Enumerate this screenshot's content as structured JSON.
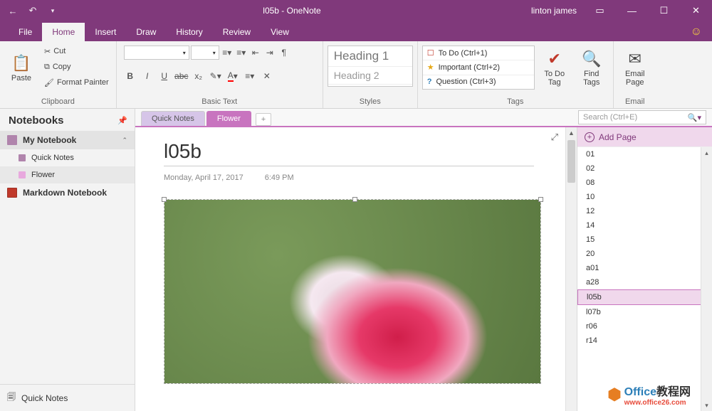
{
  "window": {
    "title": "l05b  -  OneNote",
    "user": "linton james"
  },
  "menu": {
    "file": "File",
    "home": "Home",
    "insert": "Insert",
    "draw": "Draw",
    "history": "History",
    "review": "Review",
    "view": "View"
  },
  "ribbon": {
    "clipboard": {
      "label": "Clipboard",
      "paste": "Paste",
      "cut": "Cut",
      "copy": "Copy",
      "format_painter": "Format Painter"
    },
    "basic_text": {
      "label": "Basic Text"
    },
    "styles": {
      "label": "Styles",
      "h1": "Heading 1",
      "h2": "Heading 2"
    },
    "tags": {
      "label": "Tags",
      "items": [
        {
          "icon": "☐",
          "color": "#c0392b",
          "label": "To Do (Ctrl+1)"
        },
        {
          "icon": "★",
          "color": "#e6a817",
          "label": "Important (Ctrl+2)"
        },
        {
          "icon": "?",
          "color": "#2c7fb8",
          "label": "Question (Ctrl+3)"
        }
      ],
      "todo_tag": "To Do\nTag",
      "find_tags": "Find\nTags"
    },
    "email": {
      "label": "Email",
      "email_page": "Email\nPage"
    }
  },
  "notebooks": {
    "header": "Notebooks",
    "my_notebook": "My Notebook",
    "quick_notes": "Quick Notes",
    "flower": "Flower",
    "markdown": "Markdown Notebook",
    "footer": "Quick Notes"
  },
  "sections": {
    "quick_notes": "Quick Notes",
    "flower": "Flower"
  },
  "search": {
    "placeholder": "Search (Ctrl+E)"
  },
  "page": {
    "title": "l05b",
    "date": "Monday, April 17, 2017",
    "time": "6:49 PM"
  },
  "pagelist": {
    "add": "Add Page",
    "items": [
      "01",
      "02",
      "08",
      "10",
      "12",
      "14",
      "15",
      "20",
      "a01",
      "a28",
      "l05b",
      "l07b",
      "r06",
      "r14"
    ],
    "selected": "l05b"
  },
  "watermark": {
    "brand": "Office",
    "suffix": "教程网",
    "url": "www.office26.com"
  }
}
